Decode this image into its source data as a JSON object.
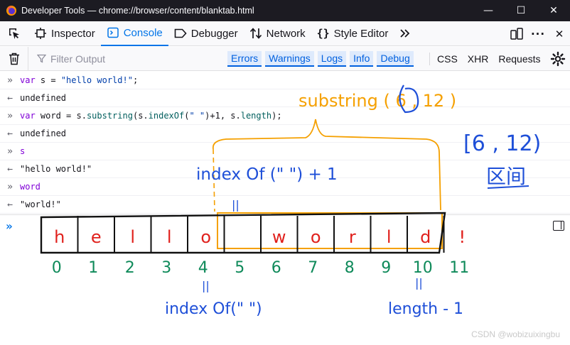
{
  "window": {
    "title": "Developer Tools — chrome://browser/content/blanktab.html",
    "controls": [
      "—",
      "☐",
      "✕"
    ]
  },
  "tabs": [
    {
      "label": "Inspector",
      "icon": "inspector-icon",
      "active": false
    },
    {
      "label": "Console",
      "icon": "console-icon",
      "active": true
    },
    {
      "label": "Debugger",
      "icon": "debugger-icon",
      "active": false
    },
    {
      "label": "Network",
      "icon": "network-icon",
      "active": false
    },
    {
      "label": "Style Editor",
      "icon": "style-editor-icon",
      "active": false
    }
  ],
  "toolbar": {
    "filter_placeholder": "Filter Output",
    "chips": [
      "Errors",
      "Warnings",
      "Logs",
      "Info",
      "Debug"
    ],
    "plain": [
      "CSS",
      "XHR",
      "Requests"
    ]
  },
  "messages": [
    {
      "type": "input",
      "parts": [
        [
          "kw",
          "var"
        ],
        [
          "out",
          " s = "
        ],
        [
          "str",
          "\"hello world!\""
        ],
        [
          "out",
          ";"
        ]
      ]
    },
    {
      "type": "result",
      "parts": [
        [
          "out",
          "undefined"
        ]
      ]
    },
    {
      "type": "input",
      "parts": [
        [
          "kw",
          "var"
        ],
        [
          "out",
          " word = s."
        ],
        [
          "prop",
          "substring"
        ],
        [
          "out",
          "(s."
        ],
        [
          "prop",
          "indexOf"
        ],
        [
          "out",
          "("
        ],
        [
          "str",
          "\" \""
        ],
        [
          "out",
          ")+1, s."
        ],
        [
          "prop",
          "length"
        ],
        [
          "out",
          ");"
        ]
      ]
    },
    {
      "type": "result",
      "parts": [
        [
          "out",
          "undefined"
        ]
      ]
    },
    {
      "type": "input",
      "parts": [
        [
          "kw",
          "s"
        ]
      ]
    },
    {
      "type": "result",
      "parts": [
        [
          "out",
          "\"hello world!\""
        ]
      ]
    },
    {
      "type": "input",
      "parts": [
        [
          "kw",
          "word"
        ]
      ]
    },
    {
      "type": "result",
      "parts": [
        [
          "out",
          "\"world!\""
        ]
      ]
    }
  ],
  "annotation": {
    "substring_note": "substring ( 6 , 12 )",
    "range_note": "[6 , 12)",
    "range_label": "区间",
    "indexof_plus_note": "index Of (\" \") + 1",
    "equals_mark": "||",
    "chars": [
      "h",
      "e",
      "l",
      "l",
      "o",
      " ",
      "w",
      "o",
      "r",
      "l",
      "d",
      "!"
    ],
    "indices": [
      "0",
      "1",
      "2",
      "3",
      "4",
      "5",
      "6",
      "7",
      "8",
      "9",
      "10",
      "11"
    ],
    "indexof_note": "index Of(\" \")",
    "length_note": "length - 1",
    "colors": {
      "handwriting_blue": "#1e4fd8",
      "handwriting_red": "#e0201c",
      "handwriting_green": "#0f8a5a",
      "highlight_orange": "#f5a000"
    }
  },
  "watermark": "CSDN @wobizuixingbu"
}
